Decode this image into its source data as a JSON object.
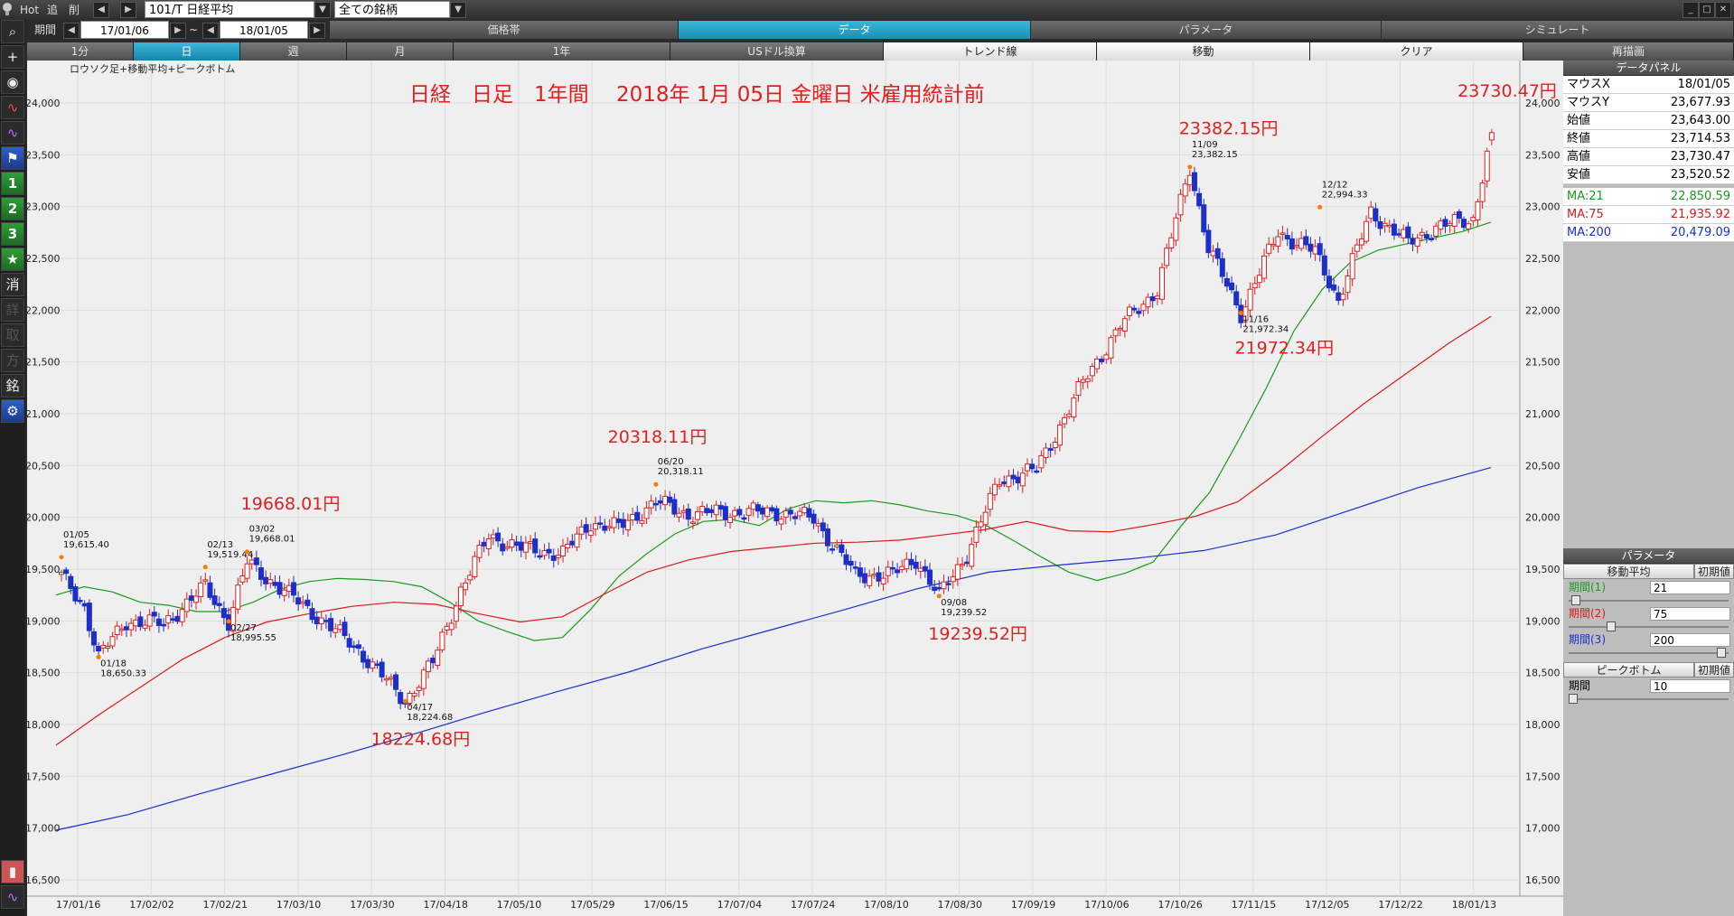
{
  "toolbar": {
    "hot_label": "Hot",
    "add_label": "追",
    "del_label": "削",
    "symbol_value": "101/T 日経平均",
    "universe_value": "全ての銘柄"
  },
  "period_bar": {
    "label": "期間",
    "from_date": "17/01/06",
    "separator": "~",
    "to_date": "18/01/05",
    "panel_tabs": [
      "価格帯",
      "データ",
      "パラメータ",
      "シミュレート"
    ],
    "active_panel_tab": "データ"
  },
  "row3": {
    "interval_buttons": [
      "1分",
      "日",
      "週",
      "月"
    ],
    "active_interval": "日",
    "range_button": "1年",
    "usd_button": "USドル換算",
    "trend_button": "トレンド線",
    "move_button": "移動",
    "clear_button": "クリア",
    "redraw_button": "再描画"
  },
  "left_tools": {
    "one": "1",
    "two": "2",
    "three": "3",
    "erase": "消",
    "k1": "詳",
    "k2": "取",
    "k3": "方",
    "k4": "銘"
  },
  "chart_title_small": "ロウソク足+移動平均+ピークボトム",
  "chart_headline": "日経　日足　1年間　 2018年 1月 05日 金曜日 米雇用統計前",
  "data_panel": {
    "header": "データパネル",
    "rows": [
      {
        "k": "マウスX",
        "v": "18/01/05"
      },
      {
        "k": "マウスY",
        "v": "23,677.93"
      },
      {
        "k": "始値",
        "v": "23,643.00"
      },
      {
        "k": "終値",
        "v": "23,714.53"
      },
      {
        "k": "高値",
        "v": "23,730.47"
      },
      {
        "k": "安値",
        "v": "23,520.52"
      }
    ],
    "ma_rows": [
      {
        "k": "MA:21",
        "v": "22,850.59",
        "color": "#1a9b1a"
      },
      {
        "k": "MA:75",
        "v": "21,935.92",
        "color": "#d81b1b"
      },
      {
        "k": "MA:200",
        "v": "20,479.09",
        "color": "#1c2fc8"
      }
    ]
  },
  "param_panel": {
    "header": "パラメータ",
    "ma_section": "移動平均",
    "ma_reset": "初期値",
    "ma_params": [
      {
        "label": "期間(1)",
        "value": "21",
        "color": "#1a9b1a",
        "slider": 0.02
      },
      {
        "label": "期間(2)",
        "value": "75",
        "color": "#d81b1b",
        "slider": 0.25
      },
      {
        "label": "期間(3)",
        "value": "200",
        "color": "#1c2fc8",
        "slider": 0.98
      }
    ],
    "pb_section": "ピークボトム",
    "pb_reset": "初期値",
    "pb_label": "期間",
    "pb_value": "10",
    "pb_slider": 0.0
  },
  "chart_data": {
    "type": "candlestick",
    "ylim": [
      16500,
      24000
    ],
    "yticks": [
      16500,
      17000,
      17500,
      18000,
      18500,
      19000,
      19500,
      20000,
      20500,
      21000,
      21500,
      22000,
      22500,
      23000,
      23500,
      24000
    ],
    "ytick_labels": [
      "16,500",
      "17,000",
      "17,500",
      "18,000",
      "18,500",
      "19,000",
      "19,500",
      "20,000",
      "20,500",
      "21,000",
      "21,500",
      "22,000",
      "22,500",
      "23,000",
      "23,500",
      "24,000"
    ],
    "x_tick_labels": [
      "17/01/16",
      "17/02/02",
      "17/02/21",
      "17/03/10",
      "17/03/30",
      "17/04/18",
      "17/05/10",
      "17/05/29",
      "17/06/15",
      "17/07/04",
      "17/07/24",
      "17/08/10",
      "17/08/30",
      "17/09/19",
      "17/10/06",
      "17/10/26",
      "17/11/15",
      "17/12/05",
      "17/12/22",
      "18/01/13"
    ],
    "series": [
      {
        "name": "MA:21",
        "color": "#1a9b1a",
        "values": [
          19250,
          19330,
          19280,
          19180,
          19150,
          19090,
          19090,
          19180,
          19310,
          19380,
          19410,
          19400,
          19380,
          19330,
          19180,
          19000,
          18900,
          18810,
          18840,
          19110,
          19430,
          19650,
          19840,
          19960,
          19980,
          19920,
          20080,
          20160,
          20140,
          20160,
          20120,
          20060,
          20020,
          19930,
          19780,
          19620,
          19470,
          19390,
          19460,
          19570,
          19920,
          20240,
          20730,
          21240,
          21800,
          22200,
          22460,
          22580,
          22640,
          22700,
          22760,
          22850
        ]
      },
      {
        "name": "MA:75",
        "color": "#d81b1b",
        "values": [
          17800,
          18090,
          18360,
          18630,
          18840,
          18990,
          19070,
          19140,
          19180,
          19160,
          19070,
          18990,
          19040,
          19260,
          19470,
          19590,
          19670,
          19710,
          19750,
          19760,
          19780,
          19830,
          19880,
          19960,
          19870,
          19860,
          19930,
          20010,
          20150,
          20450,
          20780,
          21100,
          21390,
          21680,
          21940
        ]
      },
      {
        "name": "MA:200",
        "color": "#1c2fc8",
        "values": [
          16980,
          17130,
          17330,
          17520,
          17710,
          17910,
          18120,
          18320,
          18510,
          18730,
          18920,
          19110,
          19310,
          19470,
          19540,
          19600,
          19680,
          19830,
          20060,
          20290,
          20480
        ]
      }
    ],
    "candles": {
      "first": 19450,
      "up_color": "#e02020",
      "down_color": "#1c2fc8",
      "waypoints": [
        [
          0,
          19430
        ],
        [
          5,
          19140
        ],
        [
          8,
          18650
        ],
        [
          14,
          19000
        ],
        [
          22,
          18970
        ],
        [
          31,
          19330
        ],
        [
          36,
          18995
        ],
        [
          40,
          19560
        ],
        [
          47,
          19320
        ],
        [
          55,
          19050
        ],
        [
          64,
          18720
        ],
        [
          74,
          18225
        ],
        [
          80,
          18600
        ],
        [
          86,
          19300
        ],
        [
          92,
          19820
        ],
        [
          99,
          19700
        ],
        [
          108,
          19650
        ],
        [
          114,
          19950
        ],
        [
          120,
          19900
        ],
        [
          128,
          20150
        ],
        [
          135,
          20030
        ],
        [
          142,
          20050
        ],
        [
          154,
          20050
        ],
        [
          162,
          19990
        ],
        [
          171,
          19440
        ],
        [
          179,
          19450
        ],
        [
          184,
          19600
        ],
        [
          189,
          19240
        ],
        [
          195,
          19650
        ],
        [
          202,
          20360
        ],
        [
          210,
          20460
        ],
        [
          220,
          21300
        ],
        [
          228,
          21850
        ],
        [
          236,
          22200
        ],
        [
          243,
          23382
        ],
        [
          247,
          22600
        ],
        [
          254,
          21972
        ],
        [
          262,
          22750
        ],
        [
          270,
          22560
        ],
        [
          275,
          22100
        ],
        [
          282,
          22950
        ],
        [
          290,
          22650
        ],
        [
          296,
          22800
        ],
        [
          304,
          22880
        ],
        [
          308,
          23714
        ]
      ]
    },
    "peak_labels": [
      {
        "date": "01/05",
        "value": "19,615.40",
        "price": 19615.4,
        "idx": 0,
        "pos": "above"
      },
      {
        "date": "01/18",
        "value": "18,650.33",
        "price": 18650.33,
        "idx": 8,
        "pos": "below"
      },
      {
        "date": "02/13",
        "value": "19,519.44",
        "price": 19519.44,
        "idx": 31,
        "pos": "above"
      },
      {
        "date": "02/27",
        "value": "18,995.55",
        "price": 18995.55,
        "idx": 36,
        "pos": "below"
      },
      {
        "date": "03/02",
        "value": "19,668.01",
        "price": 19668.01,
        "idx": 40,
        "pos": "above"
      },
      {
        "date": "04/17",
        "value": "18,224.68",
        "price": 18224.68,
        "idx": 74,
        "pos": "below"
      },
      {
        "date": "06/20",
        "value": "20,318.11",
        "price": 20318.11,
        "idx": 128,
        "pos": "above"
      },
      {
        "date": "09/08",
        "value": "19,239.52",
        "price": 19239.52,
        "idx": 189,
        "pos": "below"
      },
      {
        "date": "11/09",
        "value": "23,382.15",
        "price": 23382.15,
        "idx": 243,
        "pos": "above"
      },
      {
        "date": "11/16",
        "value": "21,972.34",
        "price": 21972.34,
        "idx": 254,
        "pos": "below"
      },
      {
        "date": "12/12",
        "value": "22,994.33",
        "price": 22994.33,
        "idx": 271,
        "pos": "above"
      }
    ],
    "annotations": [
      {
        "text": "19668.01円",
        "price": 20075,
        "idx": 48
      },
      {
        "text": "18224.68円",
        "price": 17805,
        "idx": 76
      },
      {
        "text": "20318.11円",
        "price": 20720,
        "idx": 127
      },
      {
        "text": "19239.52円",
        "price": 18820,
        "idx": 196
      },
      {
        "text": "23382.15円",
        "price": 23700,
        "idx": 250
      },
      {
        "text": "21972.34円",
        "price": 21580,
        "idx": 262
      },
      {
        "text": "23730.47円",
        "price": 24060,
        "idx": 310
      }
    ]
  }
}
